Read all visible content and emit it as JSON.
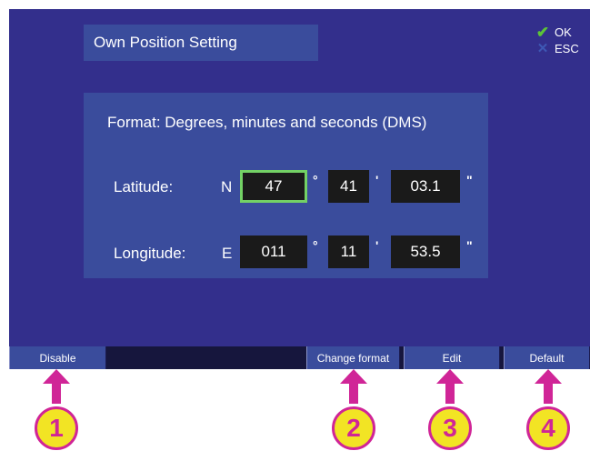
{
  "screen": {
    "title": "Own Position Setting",
    "actions": {
      "ok_label": "OK",
      "esc_label": "ESC"
    }
  },
  "panel": {
    "format_text": "Format: Degrees, minutes and seconds (DMS)",
    "latitude": {
      "label": "Latitude:",
      "hemisphere": "N",
      "degrees": "47",
      "minutes": "41",
      "seconds": "03.1"
    },
    "longitude": {
      "label": "Longitude:",
      "hemisphere": "E",
      "degrees": "011",
      "minutes": "11",
      "seconds": "53.5"
    },
    "units": {
      "degree": "°",
      "minute": "'",
      "second": "\""
    }
  },
  "softkeys": {
    "disable": "Disable",
    "change_format": "Change format",
    "edit": "Edit",
    "default": "Default"
  },
  "callouts": [
    "1",
    "2",
    "3",
    "4"
  ],
  "colors": {
    "screen_bg": "#332f8c",
    "panel_bg": "#3a4c9c",
    "focus": "#73d165",
    "callout_fill": "#f2e424",
    "callout_stroke": "#d02597"
  }
}
